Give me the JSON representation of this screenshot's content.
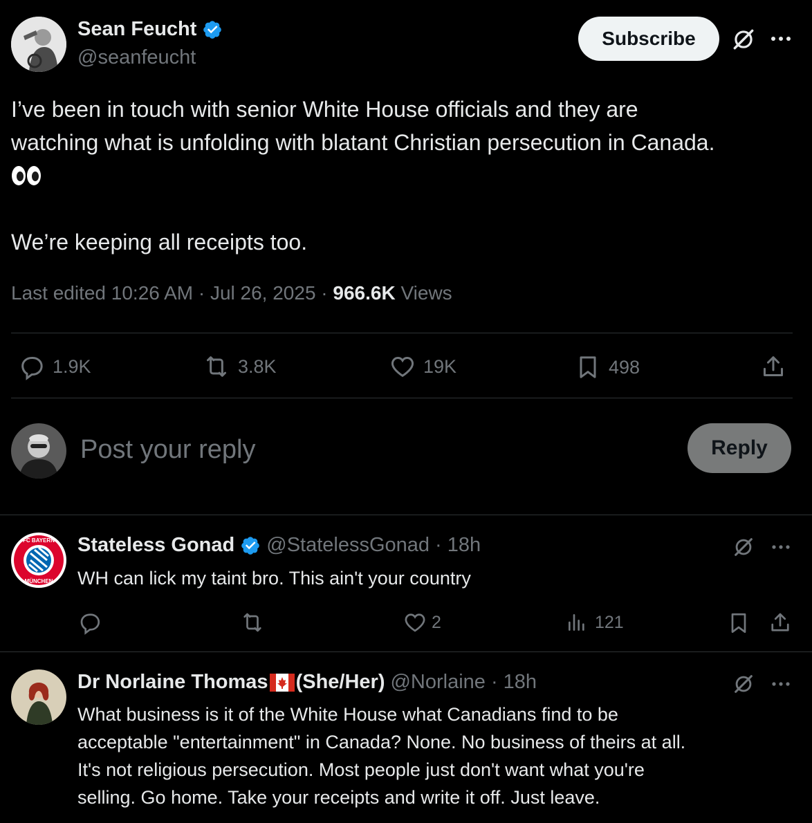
{
  "post": {
    "author_name": "Sean Feucht",
    "author_handle": "@seanfeucht",
    "subscribe_label": "Subscribe",
    "text_line1": "I’ve been in touch with senior White House officials and they are",
    "text_line2": "watching what is unfolding with blatant Christian persecution in Canada.",
    "emoji": "👀",
    "text_line3": "We’re keeping all receipts too.",
    "edited_time": "Last edited 10:26 AM · Jul 26, 2025 · ",
    "views_count": "966.6K",
    "views_label": " Views",
    "stats": {
      "replies": "1.9K",
      "reposts": "3.8K",
      "likes": "19K",
      "bookmarks": "498"
    }
  },
  "composer": {
    "placeholder": "Post your reply",
    "reply_button": "Reply"
  },
  "replies": [
    {
      "name": "Stateless Gonad",
      "handle": "@StatelessGonad",
      "time": "· 18h",
      "text": "WH can lick my taint bro. This ain't your country",
      "likes": "2",
      "views": "121"
    },
    {
      "name": "Dr Norlaine Thomas",
      "flag": "🇨🇦",
      "pronouns": "(She/Her)",
      "handle": "@Norlaine",
      "time": "· 18h",
      "lines": [
        "What business is it of the White House what Canadians find to be",
        "acceptable \"entertainment\" in Canada? None. No business of theirs at all.",
        "It's not religious persecution. Most people just don't want what you're",
        "selling. Go home. Take your receipts and write it off. Just leave."
      ]
    }
  ],
  "colors": {
    "background": "#000000",
    "text": "#e7e9ea",
    "muted": "#71767b",
    "verified": "#1d9bf0",
    "divider": "#2f3336",
    "reply_button_bg": "#787a7a"
  }
}
